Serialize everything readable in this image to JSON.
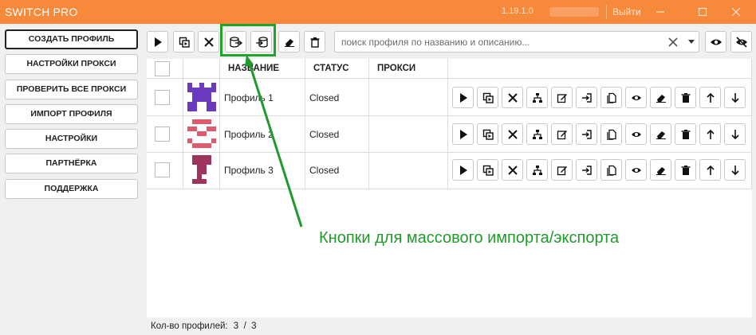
{
  "titlebar": {
    "title": "SWITCH PRO",
    "version": "1.19.1.0",
    "logout": "Выйти"
  },
  "sidebar": {
    "items": [
      {
        "label": "СОЗДАТЬ ПРОФИЛЬ"
      },
      {
        "label": "НАСТРОЙКИ ПРОКСИ"
      },
      {
        "label": "ПРОВЕРИТЬ ВСЕ ПРОКСИ"
      },
      {
        "label": "ИМПОРТ ПРОФИЛЯ"
      },
      {
        "label": "НАСТРОЙКИ"
      },
      {
        "label": "ПАРТНЁРКА"
      },
      {
        "label": "ПОДДЕРЖКА"
      }
    ]
  },
  "toolbar": {
    "icons": [
      "play-icon",
      "copy-run-icon",
      "close-icon",
      "export-db-icon",
      "import-db-icon",
      "eraser-icon",
      "trash-icon"
    ]
  },
  "search": {
    "placeholder": "поиск профиля по названию и описанию...",
    "value": ""
  },
  "table": {
    "columns": [
      "НАЗВАНИЕ",
      "СТАТУС",
      "ПРОКСИ"
    ],
    "rows": [
      {
        "name": "Профиль 1",
        "status": "Closed",
        "proxy": "",
        "avatar_color": "#6a3bbf"
      },
      {
        "name": "Профиль 2",
        "status": "Closed",
        "proxy": "",
        "avatar_color": "#e05a6e"
      },
      {
        "name": "Профиль 3",
        "status": "Closed",
        "proxy": "",
        "avatar_color": "#a0325e"
      }
    ],
    "row_actions": [
      "play-icon",
      "copy-run-icon",
      "close-icon",
      "network-icon",
      "edit-icon",
      "export-icon",
      "duplicate-icon",
      "eye-icon",
      "eraser-icon",
      "trash-icon",
      "arrow-up-icon",
      "arrow-down-icon"
    ]
  },
  "annotation": "Кнопки для массового импорта/экспорта",
  "footer": {
    "label": "Кол-во профилей:",
    "count": "3  /  3"
  },
  "colors": {
    "titlebar": "#f7893a",
    "highlight": "#22a32a"
  }
}
